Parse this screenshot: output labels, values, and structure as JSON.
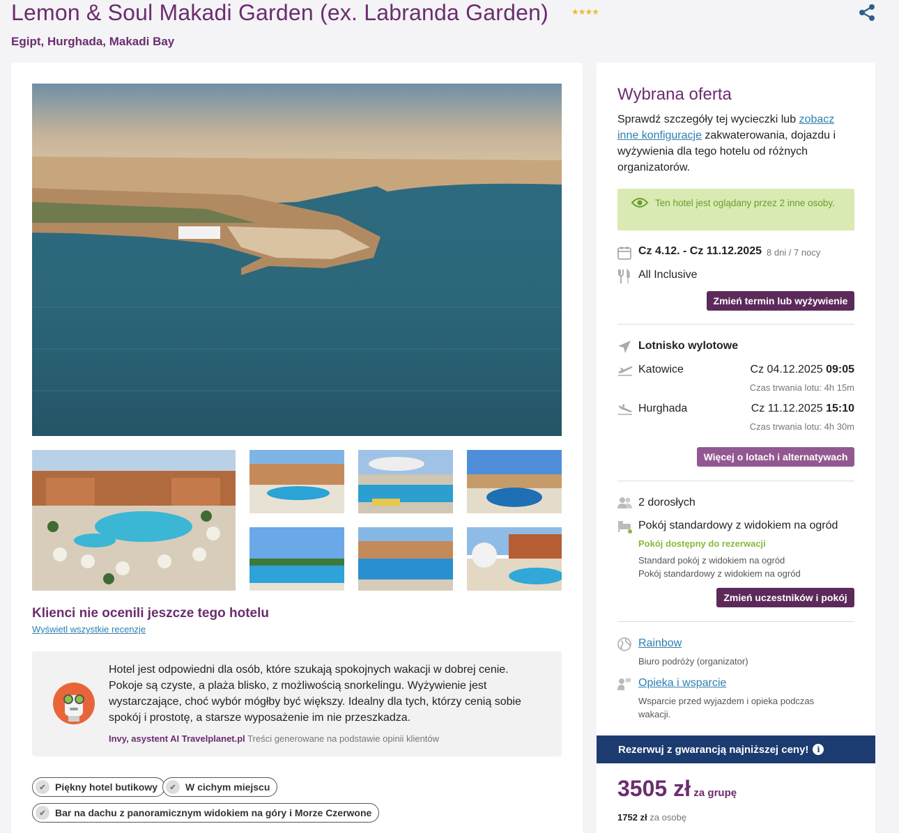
{
  "hotel": {
    "name": "Lemon & Soul Makadi Garden (ex. Labranda Garden)",
    "stars": "★★★★",
    "location": "Egipt, Hurghada, Makadi Bay"
  },
  "reviews": {
    "title": "Klienci nie ocenili jeszcze tego hotelu",
    "link": "Wyświetl wszystkie recenzje"
  },
  "ai_summary": {
    "text": "Hotel jest odpowiedni dla osób, które szukają spokojnych wakacji w dobrej cenie. Pokoje są czyste, a plaża blisko, z możliwością snorkelingu. Wyżywienie jest wystarczające, choć wybór mógłby być większy. Idealny dla tych, którzy cenią sobie spokój i prostotę, a starsze wyposażenie im nie przeszkadza.",
    "author": "Invy, asystent AI Travelplanet.pl",
    "note": "Treści generowane na podstawie opinii klientów"
  },
  "tags": [
    "Piękny hotel butikowy",
    "W cichym miejscu",
    "Bar na dachu z panoramicznym widokiem na góry i Morze Czerwone"
  ],
  "offer": {
    "title": "Wybrana oferta",
    "desc_before": "Sprawdź szczegóły tej wycieczki lub ",
    "desc_link": "zobacz inne konfiguracje",
    "desc_after": " zakwaterowania, dojazdu i wyżywienia dla tego hotelu od różnych organizatorów.",
    "viewers": "Ten hotel jest oglądany przez 2 inne osoby.",
    "dates": "Cz 4.12. - Cz 11.12.2025",
    "duration": "8 dni / 7 nocy",
    "board": "All Inclusive",
    "change_term_button": "Zmień termin lub wyżywienie"
  },
  "flights": {
    "title": "Lotnisko wylotowe",
    "outbound": {
      "city": "Katowice",
      "date": "Cz 04.12.2025",
      "time": "09:05",
      "duration": "Czas trwania lotu: 4h 15m"
    },
    "return": {
      "city": "Hurghada",
      "date": "Cz 11.12.2025",
      "time": "15:10",
      "duration": "Czas trwania lotu: 4h 30m"
    },
    "more_button": "Więcej o lotach i alternatywach"
  },
  "room": {
    "pax": "2 dorosłych",
    "name": "Pokój standardowy z widokiem na ogród",
    "availability": "Pokój dostępny do rezerwacji",
    "detail1": "Standard pokój z widokiem na ogród",
    "detail2": "Pokój standardowy z widokiem na ogród",
    "change_button": "Zmień uczestników i pokój"
  },
  "organizer": {
    "name": "Rainbow",
    "role": "Biuro podróży (organizator)",
    "support_link": "Opieka i wsparcie",
    "support_desc": "Wsparcie przed wyjazdem i opieka podczas wakacji."
  },
  "booking": {
    "guarantee": "Rezerwuj z gwarancją najniższej ceny!",
    "info_icon": "i",
    "price": "3505 zł",
    "price_per": "za grupę",
    "price_person": "1752 zł",
    "price_person_label": "za osobę"
  },
  "colors": {
    "brand": "#6b2d6e",
    "button": "#5c2a5a",
    "guarantee": "#1c3b70",
    "success": "#8ab83b"
  },
  "icons": [
    "share-icon",
    "calendar-icon",
    "fork-knife-icon",
    "location-arrow-icon",
    "plane-takeoff-icon",
    "plane-landing-icon",
    "people-icon",
    "bed-icon",
    "globe-icon",
    "support-icon",
    "eye-icon",
    "info-icon",
    "check-icon"
  ]
}
